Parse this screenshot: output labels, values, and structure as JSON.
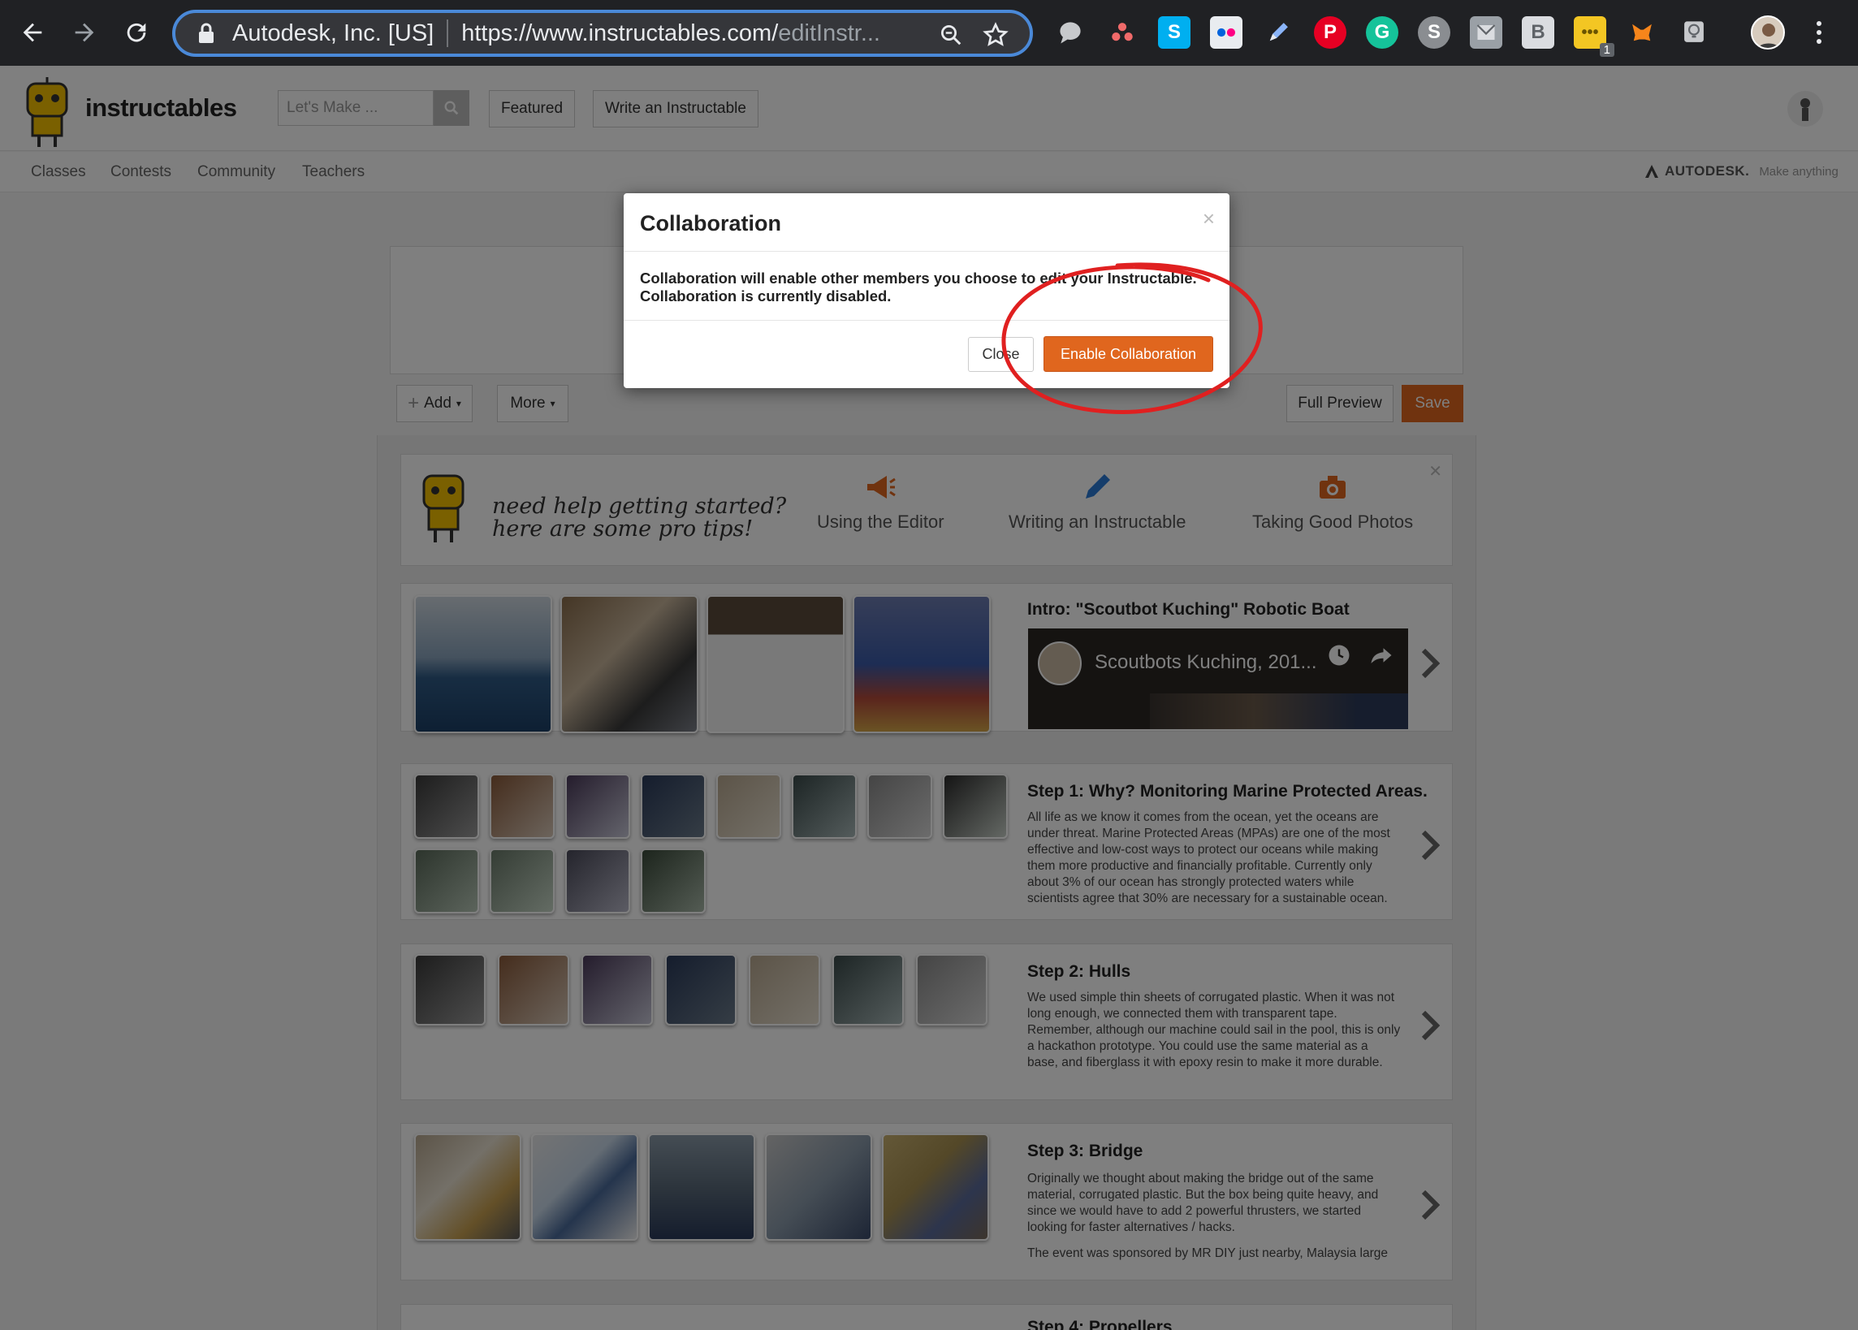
{
  "browser": {
    "site_identity": "Autodesk, Inc. [US]",
    "url_main": "https://www.instructables.com/",
    "url_rest": "editInstr...",
    "extensions": [
      {
        "name": "chat-bubble-icon"
      },
      {
        "name": "asana-icon",
        "color": "#f06a6a"
      },
      {
        "name": "skype-icon",
        "color": "#00aff0",
        "glyph": "S"
      },
      {
        "name": "flickr-icon"
      },
      {
        "name": "pen-icon"
      },
      {
        "name": "pinterest-icon",
        "color": "#e60023",
        "glyph": "P"
      },
      {
        "name": "grammarly-icon",
        "color": "#15c39a",
        "glyph": "G"
      },
      {
        "name": "skype-grey-icon",
        "color": "#8a8d91",
        "glyph": "S"
      },
      {
        "name": "inbox-icon"
      },
      {
        "name": "b-icon",
        "glyph": "B"
      },
      {
        "name": "sticky-note-icon",
        "color": "#f3c623",
        "badge": "1"
      },
      {
        "name": "metamask-fox-icon",
        "color": "#f6851b"
      },
      {
        "name": "lightbulb-icon"
      }
    ]
  },
  "site": {
    "logo_text": "instructables",
    "search_placeholder": "Let's Make ...",
    "header_buttons": [
      "Featured",
      "Write an Instructable"
    ],
    "subnav": [
      "Classes",
      "Contests",
      "Community",
      "Teachers"
    ],
    "autodesk_brand": "AUTODESK.",
    "autodesk_tagline": "Make anything"
  },
  "editor": {
    "add_label": "Add",
    "more_label": "More",
    "full_preview_label": "Full Preview",
    "save_label": "Save",
    "tips": {
      "line1": "need help getting started?",
      "line2": "here are some pro tips!",
      "items": [
        "Using the Editor",
        "Writing an Instructable",
        "Taking Good Photos"
      ]
    },
    "steps": [
      {
        "title": "Intro: \"Scoutbot Kuching\" Robotic Boat",
        "video_title": "Scoutbots Kuching, 201..."
      },
      {
        "title": "Step 1: Why? Monitoring Marine Protected Areas.",
        "body": "All life as we know it comes from the ocean, yet the oceans are under threat. Marine Protected Areas (MPAs) are one of the most effective and low-cost ways to protect our oceans while making them more productive and financially profitable. Currently only about 3% of our ocean has strongly protected waters while scientists agree that 30% are necessary for a sustainable ocean."
      },
      {
        "title": "Step 2: Hulls",
        "body": "We used simple thin sheets of corrugated plastic. When it was not long enough, we connected them with transparent tape. Remember, although our machine could sail in the pool, this is only a hackathon prototype. You could use the same material as a base, and fiberglass it with epoxy resin to make it more durable."
      },
      {
        "title": "Step 3: Bridge",
        "body": "Originally we thought about making the bridge out of the same material, corrugated plastic. But the box being quite heavy, and since we would have to add 2 powerful thrusters, we started looking for faster alternatives / hacks.",
        "body2": "The event was sponsored by MR DIY just nearby, Malaysia large hardware store chain. We found a metal shoe rack that really"
      },
      {
        "title": "Step 4: Propellers"
      }
    ]
  },
  "modal": {
    "title": "Collaboration",
    "body_line1": "Collaboration will enable other members you choose to edit your Instructable.",
    "body_line2": "Collaboration is currently disabled.",
    "close_label": "Close",
    "enable_label": "Enable Collaboration",
    "accent_color": "#e0661e",
    "annotation_color": "#e02020"
  }
}
